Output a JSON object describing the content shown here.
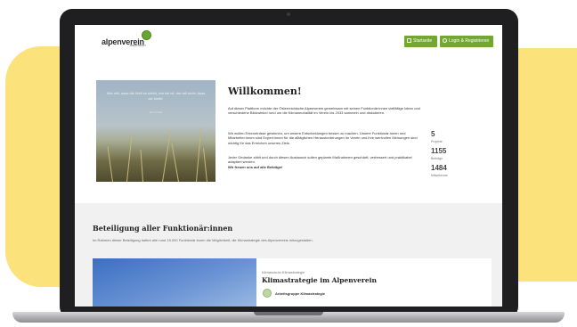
{
  "header": {
    "logo_text": "alpenverein",
    "logo_sub": "österreich",
    "home_label": "Startseite",
    "login_label": "Login & Registrieren"
  },
  "hero": {
    "quote": "Wer will, dass die Welt so bleibt, wie sie ist, der will nicht, dass sie bleibt.",
    "quote_author": "Erich Fried",
    "title": "Willkommen!",
    "p1": "Auf dieser Plattform möchte der Österreichische Alpenverein gemeinsam mit seinen Funktionär:innen vielfältige Ideen und verschiedene Blickwinkel rund um die Klimaneutralität im Verein bis 2033 sammeln und diskutieren.",
    "p2": "Wir wollen Erkenntnisse gewinnen, um unsere Entscheidungen besser zu machen. Unsere Funktionär:innen und Mitarbeiter:innen sind Expert:innen für die alltäglichen Herausforderungen im Verein und ihre wertvollen Meinungen sind wichtig für das Erreichen unseres Ziels.",
    "p3": "Jeder Gedanke zählt und durch diesen Austausch sollen geplante Maßnahmen geschärft, verbessert und praktikabel adaptiert werden.",
    "p3_bold": "Wir freuen uns auf alle Beiträge!"
  },
  "stats": [
    {
      "value": "5",
      "label": "Projekte"
    },
    {
      "value": "1155",
      "label": "Beiträge"
    },
    {
      "value": "1484",
      "label": "Mitwirkende"
    }
  ],
  "section": {
    "title": "Beteiligung aller Funktionär:innen",
    "desc": "Im Rahmen dieser Beteiligung hatten alle rund 15.000 Funktionär:innen die Möglichkeit, die Klimastrategie des Alpenvereins mitzugestalten."
  },
  "card": {
    "kicker": "Klimaschutz-Klimastrategie",
    "title": "Klimastrategie im Alpenverein",
    "author": "Arbeitsgruppe Klimastrategie"
  },
  "colors": {
    "accent_green": "#72a832",
    "blob_yellow": "#fbe27a",
    "device_dark": "#1f1f22"
  }
}
